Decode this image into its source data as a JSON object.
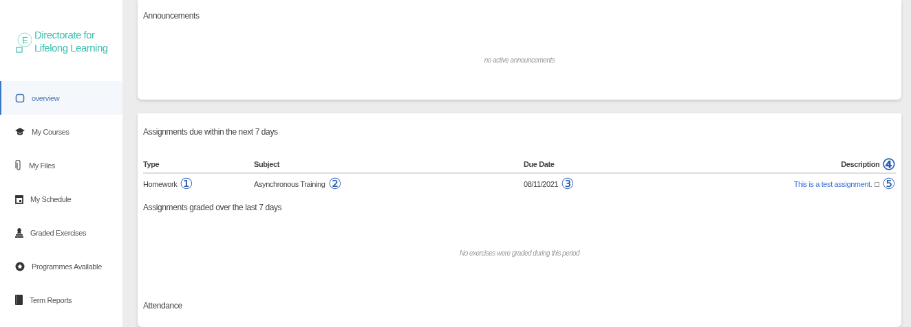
{
  "logo": {
    "letter": "E",
    "lines": [
      "Directorate for",
      "Lifelong Learning"
    ]
  },
  "sidebar": {
    "items": [
      {
        "label": "overview",
        "selected": true
      },
      {
        "label": "My Courses",
        "selected": false
      },
      {
        "label": "My Files",
        "selected": false
      },
      {
        "label": "My Schedule",
        "selected": false
      },
      {
        "label": "Graded Exercises",
        "selected": false
      },
      {
        "label": "Programmes Available",
        "selected": false
      },
      {
        "label": "Term Reports",
        "selected": false
      }
    ]
  },
  "announcements": {
    "title": "Announcements",
    "empty_text": "no active announcements"
  },
  "assignments_due": {
    "title": "Assignments due within the next 7 days",
    "columns": [
      {
        "label": "Type"
      },
      {
        "label": "Subject"
      },
      {
        "label": "Due Date"
      },
      {
        "label": "Description",
        "callout": "④"
      }
    ],
    "rows": [
      {
        "type": "Homework",
        "type_callout": "①",
        "subject": "Asynchronous Training",
        "subject_callout": "②",
        "due_date": "08/11/2021",
        "due_date_callout": "③",
        "description": "This is a test assignment.",
        "description_callout": "⑤"
      }
    ]
  },
  "assignments_graded": {
    "title": "Assignments graded over the last 7 days",
    "empty_text": "No exercises were graded during this period"
  },
  "attendance": {
    "title": "Attendance"
  }
}
